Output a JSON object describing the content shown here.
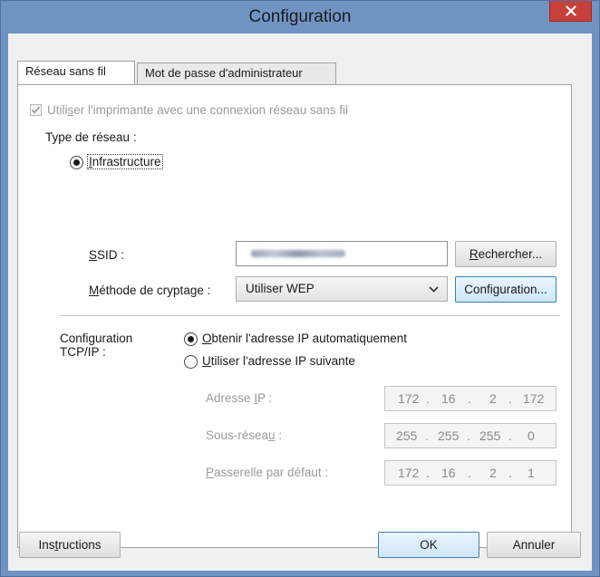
{
  "window": {
    "title": "Configuration"
  },
  "tabs": [
    {
      "label": "Réseau sans fil",
      "active": true
    },
    {
      "label": "Mot de passe d'administrateur",
      "active": false
    }
  ],
  "wireless": {
    "use_wireless_label_pre": "Utili",
    "use_wireless_label_key": "s",
    "use_wireless_label_post": "er l'imprimante avec une connexion réseau sans fil",
    "use_wireless_checked": true,
    "network_type_label": "Type de réseau :",
    "infrastructure_key": "I",
    "infrastructure_rest": "nfrastructure",
    "ssid_label_key": "S",
    "ssid_label_rest": "SID :",
    "search_button_key": "R",
    "search_button_rest": "echercher...",
    "encryption_label_key": "M",
    "encryption_label_rest": "éthode de cryptage :",
    "encryption_value": "Utiliser WEP",
    "config_button_pre": "Confi",
    "config_button_key": "g",
    "config_button_post": "uration..."
  },
  "tcpip": {
    "label_line1": "Configuration",
    "label_line2": "TCP/IP :",
    "auto_ip_key": "O",
    "auto_ip_rest": "btenir l'adresse IP automatiquement",
    "auto_ip_selected": true,
    "manual_ip_key": "U",
    "manual_ip_rest": "tiliser l'adresse IP suivante",
    "ip_label_pre": "Adresse ",
    "ip_label_key": "I",
    "ip_label_post": "P :",
    "ip_value": [
      "172",
      "16",
      "2",
      "172"
    ],
    "subnet_label_pre": "Sous-résea",
    "subnet_label_key": "u",
    "subnet_label_post": " :",
    "subnet_value": [
      "255",
      "255",
      "255",
      "0"
    ],
    "gateway_label_key": "P",
    "gateway_label_rest": "asserelle par défaut :",
    "gateway_value": [
      "172",
      "16",
      "2",
      "1"
    ]
  },
  "footer": {
    "instructions_pre": "Ins",
    "instructions_key": "t",
    "instructions_post": "ructions",
    "ok_label": "OK",
    "cancel_label": "Annuler"
  },
  "colors": {
    "title_bar": "#6f94c4",
    "close_button": "#c7403a"
  }
}
